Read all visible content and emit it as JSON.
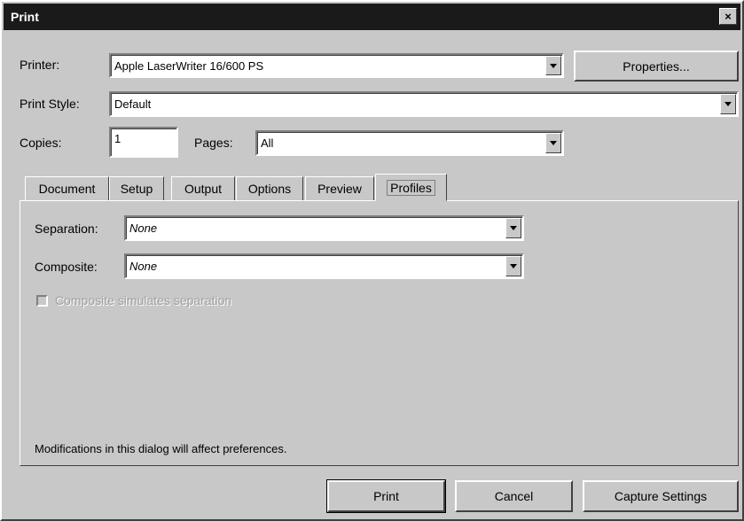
{
  "window": {
    "title": "Print",
    "close_glyph": "×"
  },
  "printer": {
    "label": "Printer:",
    "value": "Apple LaserWriter 16/600 PS",
    "properties_label": "Properties..."
  },
  "print_style": {
    "label": "Print Style:",
    "value": "Default"
  },
  "copies": {
    "label": "Copies:",
    "value": "1"
  },
  "pages": {
    "label": "Pages:",
    "value": "All"
  },
  "tabs": [
    "Document",
    "Setup",
    "Output",
    "Options",
    "Preview",
    "Profiles"
  ],
  "active_tab": "Profiles",
  "profiles": {
    "separation": {
      "label": "Separation:",
      "value": "None"
    },
    "composite": {
      "label": "Composite:",
      "value": "None"
    },
    "simulate_checkbox": {
      "label": "Composite simulates separation",
      "checked": false,
      "enabled": false
    }
  },
  "footer_note": "Modifications in this dialog will affect preferences.",
  "buttons": {
    "print": "Print",
    "cancel": "Cancel",
    "capture": "Capture Settings"
  },
  "icons": {
    "dropdown": "chevron-down-icon",
    "close": "close-icon"
  }
}
